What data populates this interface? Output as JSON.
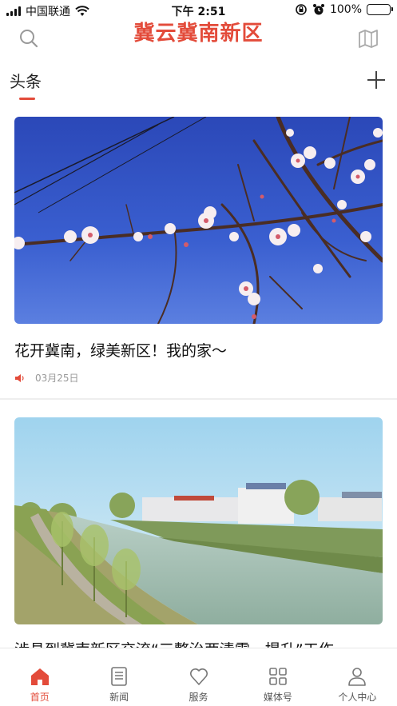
{
  "status_bar": {
    "carrier": "中国联通",
    "time": "下午 2:51",
    "battery": "100%",
    "battery_level": 1.0
  },
  "header": {
    "title": "冀云冀南新区",
    "left_icon": "search-icon",
    "right_icon": "map-icon"
  },
  "tabs": {
    "active_label": "头条",
    "add_icon": "plus-icon"
  },
  "feed": [
    {
      "title": "花开冀南，绿美新区！我的家～",
      "date": "03月25日",
      "has_audio": true
    },
    {
      "title": "涉县到冀南新区交流“三整治两清零一提升”工作",
      "date": ""
    }
  ],
  "bottom_nav": [
    {
      "label": "首页",
      "icon": "home-icon",
      "active": true
    },
    {
      "label": "新闻",
      "icon": "news-icon",
      "active": false
    },
    {
      "label": "服务",
      "icon": "heart-icon",
      "active": false
    },
    {
      "label": "媒体号",
      "icon": "grid-icon",
      "active": false
    },
    {
      "label": "个人中心",
      "icon": "user-icon",
      "active": false
    }
  ],
  "colors": {
    "accent": "#e34b3a",
    "text": "#222222",
    "muted": "#999999"
  }
}
